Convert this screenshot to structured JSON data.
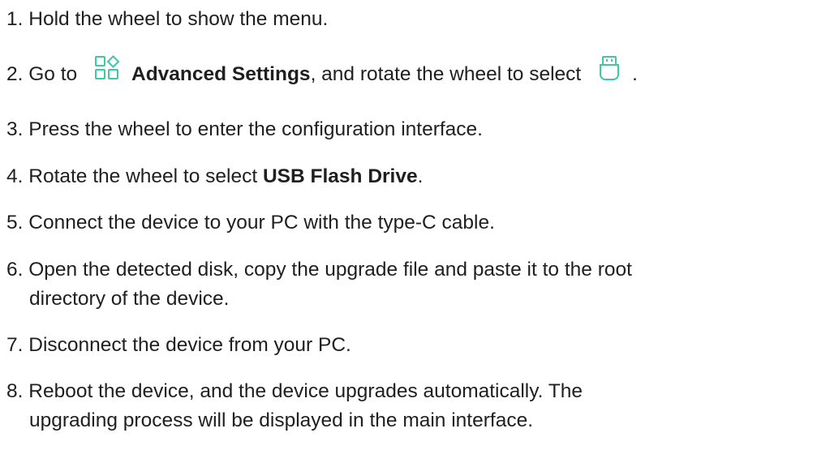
{
  "icons": {
    "advanced_settings": "advanced-settings-icon",
    "usb": "usb-icon",
    "accent_color": "#3cc9a6"
  },
  "steps": [
    {
      "num": "1.",
      "text": "Hold the wheel to show the menu."
    },
    {
      "num": "2.",
      "pre": "Go to",
      "bold": "Advanced Settings",
      "mid": ", and rotate the wheel to select",
      "post": "."
    },
    {
      "num": "3.",
      "text": "Press the wheel to enter the configuration interface."
    },
    {
      "num": "4.",
      "pre": "Rotate the wheel to select ",
      "bold": "USB Flash Drive",
      "post": "."
    },
    {
      "num": "5.",
      "text": "Connect the device to your PC with the type-C cable."
    },
    {
      "num": "6.",
      "line1": "Open the detected disk, copy the upgrade file and paste it to the root",
      "line2": "directory of the device."
    },
    {
      "num": "7.",
      "text": "Disconnect the device from your PC."
    },
    {
      "num": "8.",
      "line1": "Reboot the device, and the device upgrades automatically. The",
      "line2": "upgrading process will be displayed in the main interface."
    }
  ]
}
